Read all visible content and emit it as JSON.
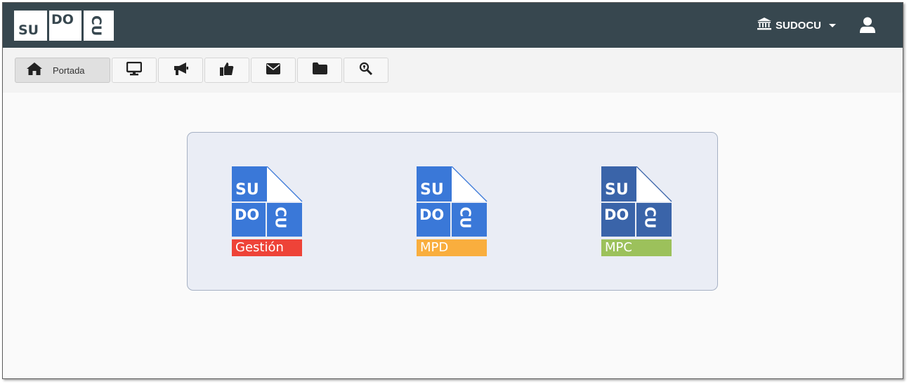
{
  "brand": {
    "logo_su": "SU",
    "logo_do": "DO",
    "logo_cu": "CU",
    "header_color": "#37474f"
  },
  "header": {
    "institution_icon": "bank-icon",
    "institution_label": "SUDOCU",
    "user_icon": "user-icon"
  },
  "toolbar": {
    "home_label": "Portada",
    "buttons": [
      {
        "icon": "home-icon"
      },
      {
        "icon": "monitor-icon"
      },
      {
        "icon": "megaphone-icon"
      },
      {
        "icon": "thumbs-up-icon"
      },
      {
        "icon": "envelope-icon"
      },
      {
        "icon": "folder-icon"
      },
      {
        "icon": "search-key-icon"
      }
    ]
  },
  "modules": [
    {
      "su": "SU",
      "do": "DO",
      "cu": "CU",
      "label": "Gestión",
      "color": "#3a78d8",
      "band_color": "#ee4338"
    },
    {
      "su": "SU",
      "do": "DO",
      "cu": "CU",
      "label": "MPD",
      "color": "#3a78d8",
      "band_color": "#f9ae3e"
    },
    {
      "su": "SU",
      "do": "DO",
      "cu": "CU",
      "label": "MPC",
      "color": "#3a64a9",
      "band_color": "#9cc15b"
    }
  ]
}
